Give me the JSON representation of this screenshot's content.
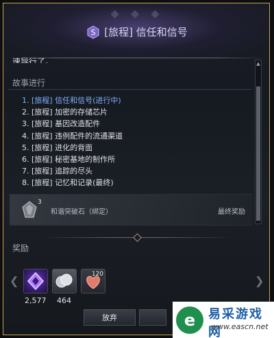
{
  "dialog": {
    "title": "[旅程] 信任和信号"
  },
  "description": {
    "visible_tail": "速导行了。"
  },
  "story": {
    "heading": "故事进行",
    "items": [
      "1. [旅程] 信任和信号(进行中)",
      "2. [旅程] 加密的存储芯片",
      "3. [旅程] 基因改造配件",
      "4. [旅程] 违例配件的流通渠道",
      "5. [旅程] 进化的背面",
      "6. [旅程] 秘密基地的制作所",
      "7. [旅程] 追踪的尽头",
      "8. [旅程] 记忆和记录(最终)"
    ]
  },
  "final_reward": {
    "count": "3",
    "name": "和谐突破石（绑定）",
    "label": "最终奖励"
  },
  "rewards": {
    "heading": "奖励",
    "items": [
      {
        "icon": "purple-crest-icon",
        "amount": "2,577"
      },
      {
        "icon": "silver-coin-icon",
        "amount": "464"
      },
      {
        "icon": "heart-icon",
        "count": "120"
      }
    ]
  },
  "buttons": {
    "abandon": "放弃",
    "second": ""
  },
  "watermark": {
    "name": "易采游戏网",
    "url": "www.eascn.net"
  },
  "colors": {
    "frame_gold": "#c9a64e",
    "active_quest": "#7fb1ff",
    "background": "#161a21"
  }
}
